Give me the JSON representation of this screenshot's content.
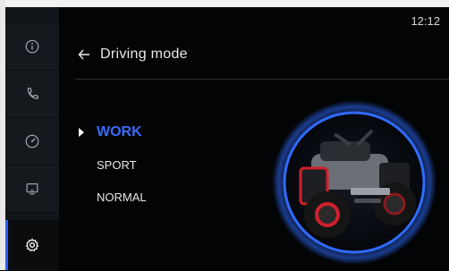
{
  "status": {
    "time": "12:12"
  },
  "sidebar": {
    "items": [
      {
        "name": "info",
        "icon": "info-icon"
      },
      {
        "name": "phone",
        "icon": "phone-icon"
      },
      {
        "name": "gauge",
        "icon": "gauge-icon"
      },
      {
        "name": "screen",
        "icon": "screen-icon"
      },
      {
        "name": "settings",
        "icon": "gear-icon",
        "active": true
      }
    ]
  },
  "header": {
    "back_icon": "back-arrow-icon",
    "title": "Driving mode"
  },
  "modes": {
    "items": [
      {
        "label": "WORK",
        "selected": true
      },
      {
        "label": "SPORT",
        "selected": false
      },
      {
        "label": "NORMAL",
        "selected": false
      }
    ]
  },
  "colors": {
    "accent": "#3b6bff",
    "ring": "#2f6bff",
    "vehicle_accent": "#d0202a"
  }
}
